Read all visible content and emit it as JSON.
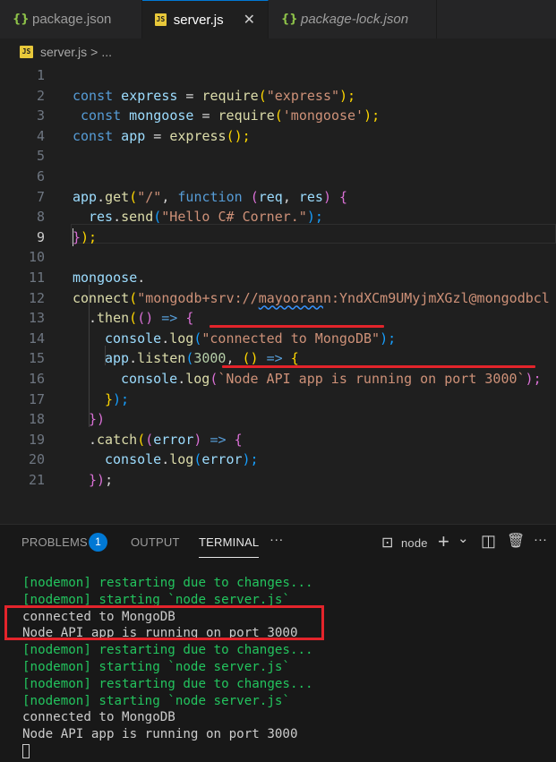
{
  "tabs": [
    {
      "label": "package.json",
      "icon": "json-icon",
      "active": false
    },
    {
      "label": "server.js",
      "icon": "js-icon",
      "active": true,
      "close": "✕"
    },
    {
      "label": "package-lock.json",
      "icon": "json-icon",
      "active": false
    }
  ],
  "icon_text": {
    "js": "JS",
    "json": "{}"
  },
  "breadcrumb": {
    "file": "server.js",
    "sep": ">",
    "more": "..."
  },
  "editor": {
    "line_numbers": [
      "1",
      "2",
      "3",
      "4",
      "5",
      "6",
      "7",
      "8",
      "9",
      "10",
      "11",
      "12",
      "13",
      "14",
      "15",
      "16",
      "17",
      "18",
      "19",
      "20",
      "21"
    ],
    "current_line": "9",
    "lines": {
      "l1": {
        "kw": "const",
        "var": " express",
        "op": " = ",
        "fn": "require",
        "p1": "(",
        "str": "\"express\"",
        "p2": ");"
      },
      "l2": {
        "kw": "const",
        "var": " mongoose",
        "op": " = ",
        "fn": "require",
        "p1": "(",
        "str": "'mongoose'",
        "p2": ");"
      },
      "l3": {
        "kw": "const",
        "var": " app",
        "op": " = ",
        "fn": "express",
        "p": "();"
      },
      "l6": {
        "var": "app",
        "dot": ".",
        "fn": "get",
        "p1": "(",
        "str": "\"/\"",
        "c": ", ",
        "kw": "function",
        "sp": " ",
        "p2": "(",
        "a1": "req",
        "c2": ", ",
        "a2": "res",
        "p3": ")",
        "arrow": " {"
      },
      "l7": {
        "var": "res",
        "dot": ".",
        "fn": "send",
        "p1": "(",
        "str": "\"Hello C# Corner.\"",
        "p2": ");"
      },
      "l8": {
        "b": "}",
        "p": ");"
      },
      "l10": {
        "var": "mongoose",
        "dot": "."
      },
      "l11": {
        "fn": "connect",
        "p1": "(",
        "s1": "\"mongodb+srv://",
        "s2": "mayooran",
        "s3": "n:YndXCm9UMyjmXGzl@mongodbcl"
      },
      "l12": {
        "dot": ".",
        "fn": "then",
        "p1": "(",
        "p2": "()",
        "arrow": " => ",
        "b": "{"
      },
      "l13": {
        "var": "console",
        "dot": ".",
        "fn": "log",
        "p1": "(",
        "str": "\"connected to MongoDB\"",
        "p2": ");"
      },
      "l14": {
        "var": "app",
        "dot": ".",
        "fn": "listen",
        "p1": "(",
        "num": "3000",
        "c": ", ",
        "p2": "()",
        "arrow": " => ",
        "b": "{"
      },
      "l15": {
        "var": "console",
        "dot": ".",
        "fn": "log",
        "p1": "(",
        "str": "`Node API app is running on port 3000`",
        "p2": ");"
      },
      "l16": {
        "b": "}",
        "p": ");"
      },
      "l17": {
        "b": "})"
      },
      "l18": {
        "dot": ".",
        "fn": "catch",
        "p1": "(",
        "p2": "(",
        "a": "error",
        "p3": ")",
        "arrow": " => ",
        "b": "{"
      },
      "l19": {
        "var": "console",
        "dot": ".",
        "fn": "log",
        "p1": "(",
        "a": "error",
        "p2": ");"
      },
      "l20": {
        "b": "})",
        "p": ";"
      }
    }
  },
  "panel": {
    "tabs": {
      "problems": "PROBLEMS",
      "output": "OUTPUT",
      "terminal": "TERMINAL",
      "more": "···"
    },
    "problems_count": "1",
    "shell": "node",
    "icons": {
      "terminal": "⊡",
      "add": "+",
      "dropdown": "⌄",
      "split": "◫",
      "trash": "🗑",
      "more": "···"
    }
  },
  "terminal": [
    {
      "text": "[nodemon] restarting due to changes...",
      "color": "green"
    },
    {
      "text": "[nodemon] starting `node server.js`",
      "color": "green"
    },
    {
      "text": "connected to MongoDB",
      "color": "white"
    },
    {
      "text": "Node API app is running on port 3000",
      "color": "white"
    },
    {
      "text": "[nodemon] restarting due to changes...",
      "color": "green"
    },
    {
      "text": "[nodemon] starting `node server.js`",
      "color": "green"
    },
    {
      "text": "[nodemon] restarting due to changes...",
      "color": "green"
    },
    {
      "text": "[nodemon] starting `node server.js`",
      "color": "green"
    },
    {
      "text": "connected to MongoDB",
      "color": "white"
    },
    {
      "text": "Node API app is running on port 3000",
      "color": "white"
    }
  ],
  "colors": {
    "accent": "#0078d4",
    "highlight": "#e3242b",
    "terminal_green": "#23c45e"
  }
}
